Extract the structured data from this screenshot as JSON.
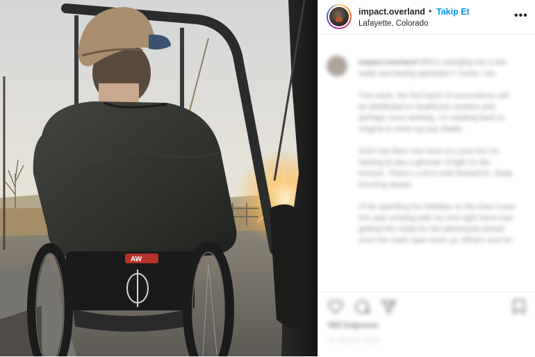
{
  "post": {
    "username": "impact.overland",
    "separator": "•",
    "follow_label": "Takip Et",
    "location": "Lafayette, Colorado",
    "more_label": "•••"
  },
  "photo": {
    "brand_mark": "AW"
  },
  "caption": {
    "author": "impact.overland",
    "paragraphs": [
      "Who's swinging into a two week and feeling optimistic? I know I am.",
      "This week, the first batch of vaccinations will be distributed to healthcare workers and perhaps more working. I'm heading back to Virginia to meet my pup Waldo",
      "2020 has been one heck of a year but I'm starting to see a glimmer of light on the horizon. There's a lot to look forward to. Keep focusing ahead.",
      "I'll be spending the holidays on the East Coast this year working with my new right hand man getting him ready for the adventures ahead once the roads open back up. What's next for"
    ]
  },
  "footer": {
    "likes": "968 beğenme",
    "timestamp": "14 ARALIK 2020"
  },
  "icons": {
    "like": "heart-icon",
    "comment": "comment-icon",
    "share": "share-icon",
    "save": "bookmark-icon"
  },
  "colors": {
    "follow": "#0095f6",
    "text": "#262626"
  }
}
